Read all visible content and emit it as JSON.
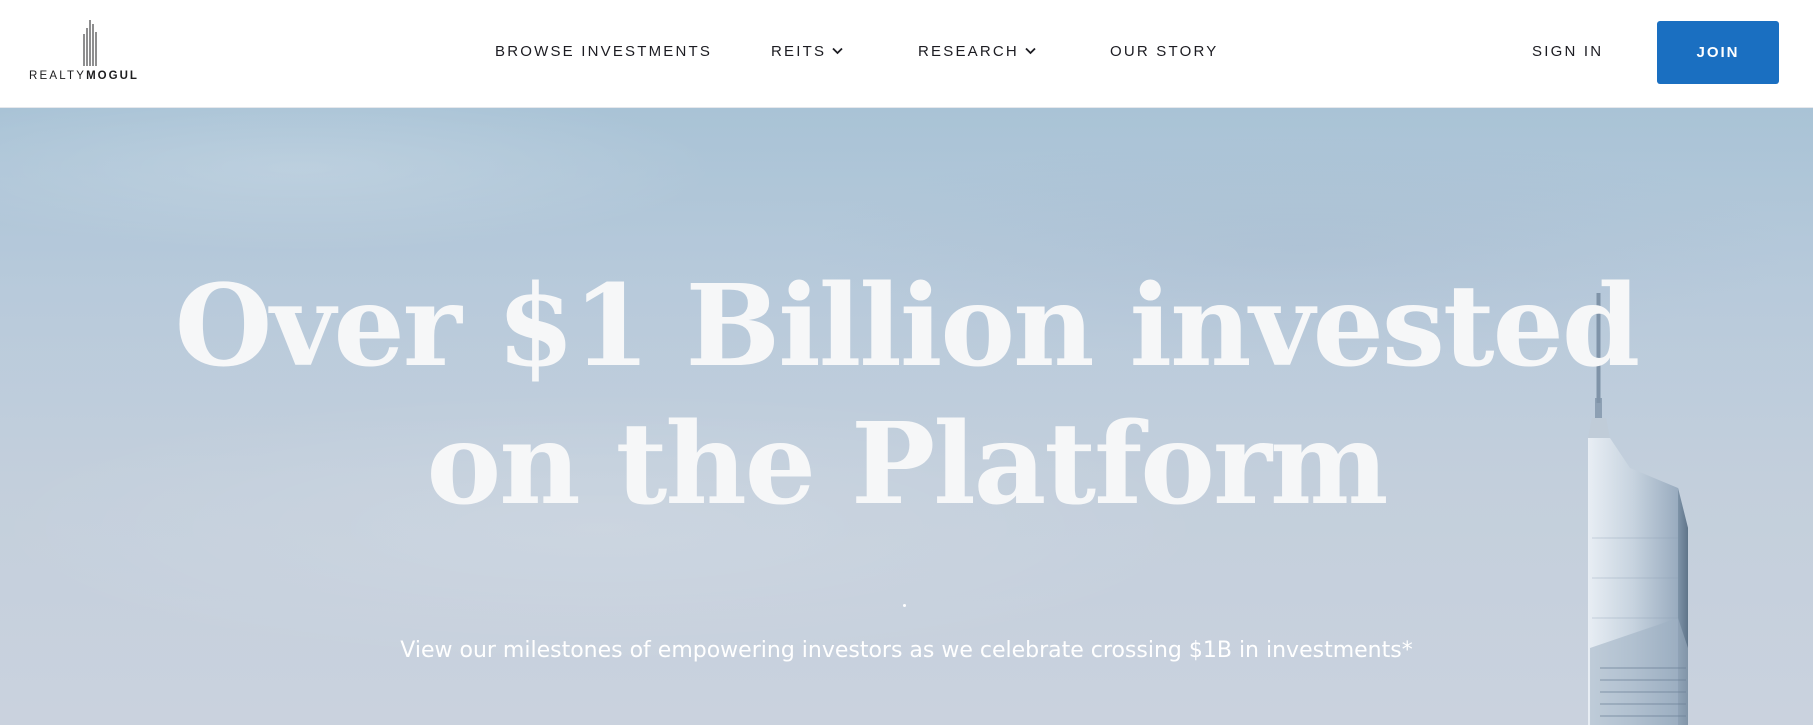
{
  "brand": {
    "logo_light": "REALTY",
    "logo_bold": "MOGUL"
  },
  "nav": {
    "browse": "BROWSE INVESTMENTS",
    "reits": "REITS",
    "research": "RESEARCH",
    "story": "OUR STORY",
    "signin": "SIGN IN",
    "join": "JOIN"
  },
  "hero": {
    "headline_line1": "Over $1 Billion invested",
    "headline_line2": "on the Platform",
    "subline": "View our milestones of empowering investors as we celebrate crossing $1B in investments*"
  },
  "colors": {
    "accent": "#1a6fc1",
    "nav_text": "#1c1c22",
    "hero_text": "#f6f7f8"
  },
  "icons": {
    "reits_dropdown": "chevron-down-icon",
    "research_dropdown": "chevron-down-icon",
    "logo": "skyscraper-icon"
  }
}
